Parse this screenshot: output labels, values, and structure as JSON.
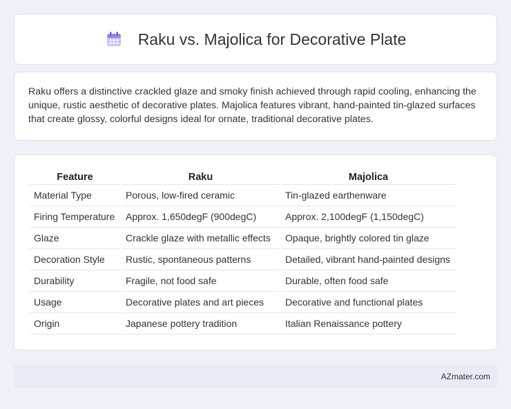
{
  "header": {
    "title": "Raku vs. Majolica for Decorative Plate",
    "icon": "calendar-icon"
  },
  "intro": {
    "text": "Raku offers a distinctive crackled glaze and smoky finish achieved through rapid cooling, enhancing the unique, rustic aesthetic of decorative plates. Majolica features vibrant, hand-painted tin-glazed surfaces that create glossy, colorful designs ideal for ornate, traditional decorative plates."
  },
  "table": {
    "headers": [
      "Feature",
      "Raku",
      "Majolica"
    ],
    "rows": [
      [
        "Material Type",
        "Porous, low-fired ceramic",
        "Tin-glazed earthenware"
      ],
      [
        "Firing Temperature",
        "Approx. 1,650degF (900degC)",
        "Approx. 2,100degF (1,150degC)"
      ],
      [
        "Glaze",
        "Crackle glaze with metallic effects",
        "Opaque, brightly colored tin glaze"
      ],
      [
        "Decoration Style",
        "Rustic, spontaneous patterns",
        "Detailed, vibrant hand-painted designs"
      ],
      [
        "Durability",
        "Fragile, not food safe",
        "Durable, often food safe"
      ],
      [
        "Usage",
        "Decorative plates and art pieces",
        "Decorative and functional plates"
      ],
      [
        "Origin",
        "Japanese pottery tradition",
        "Italian Renaissance pottery"
      ]
    ]
  },
  "footer": {
    "text": "AZmater.com"
  }
}
